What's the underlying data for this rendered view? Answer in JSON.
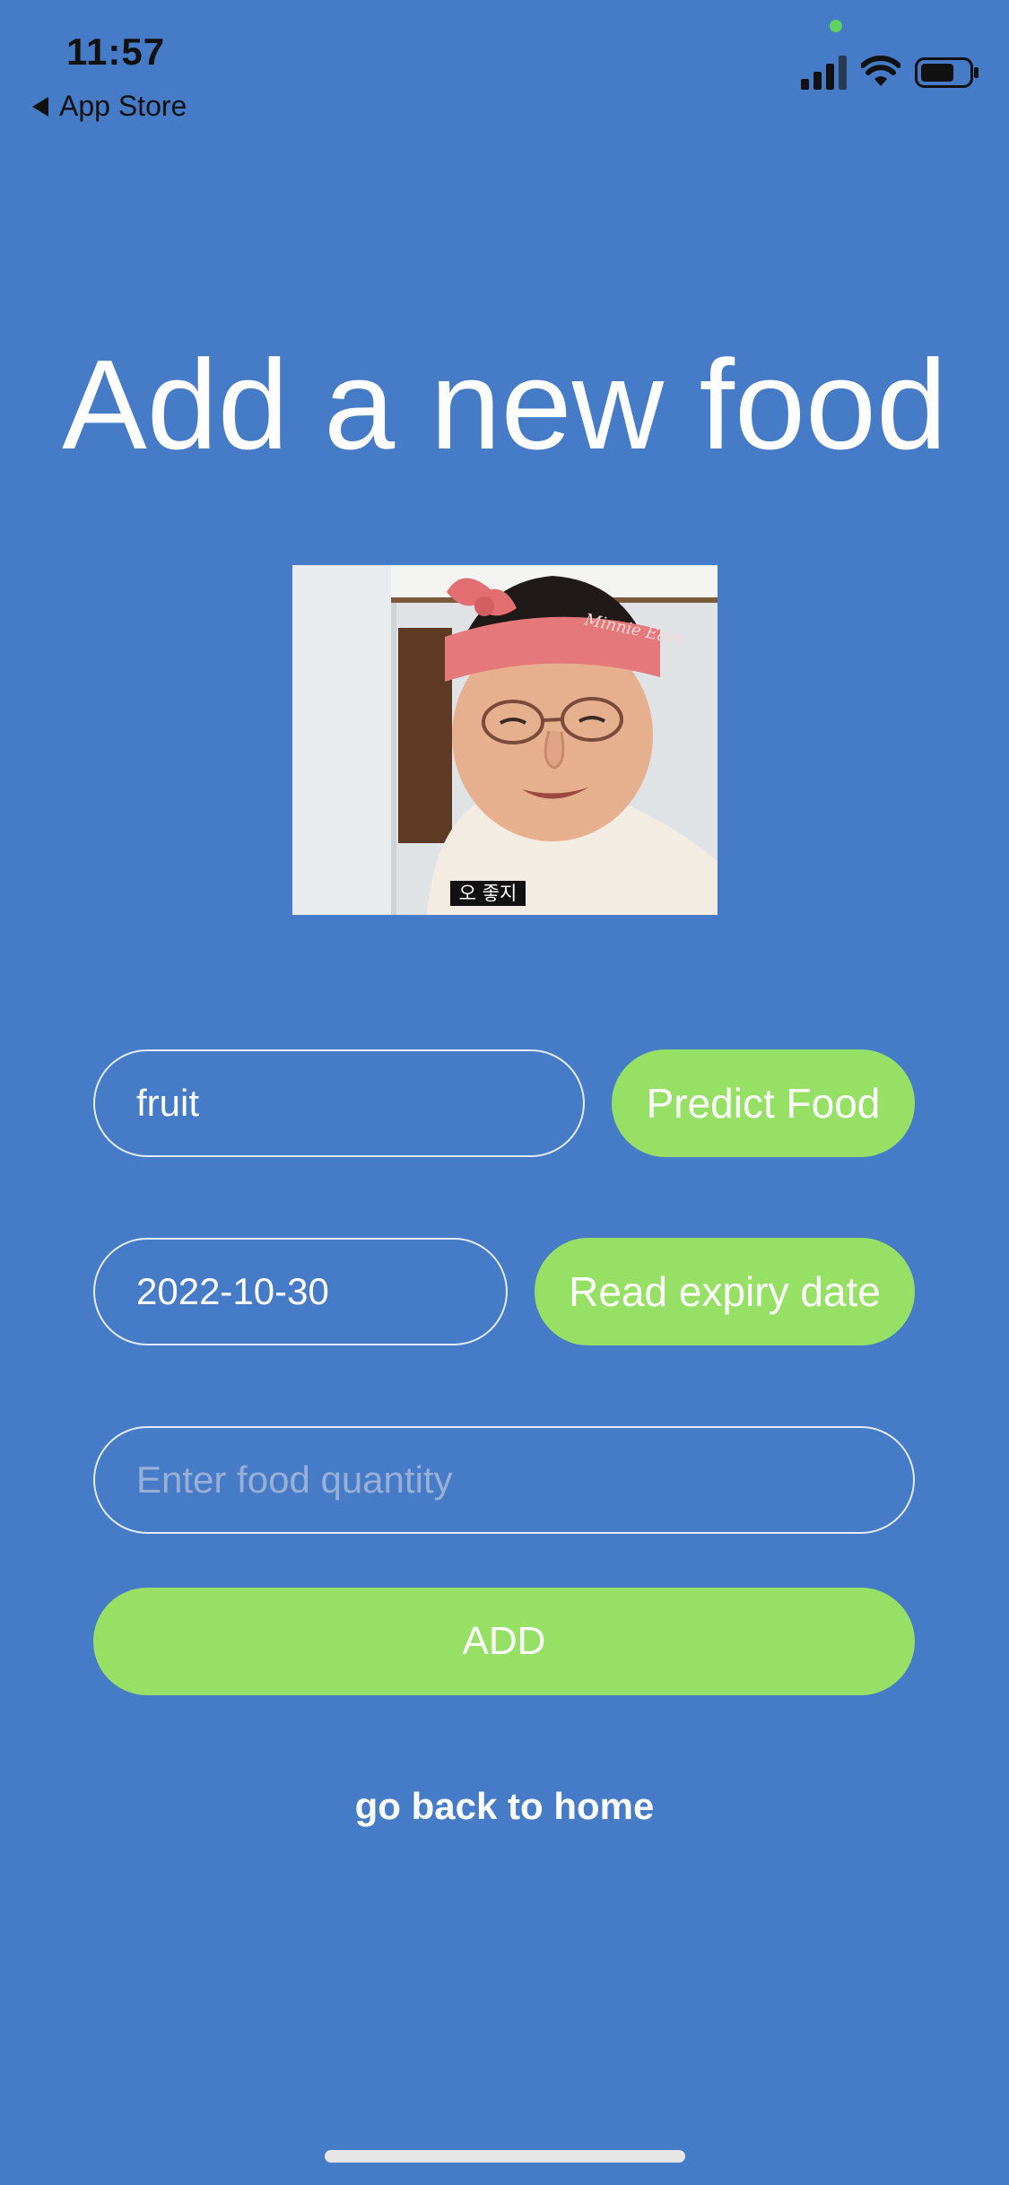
{
  "status_bar": {
    "time": "11:57",
    "back_label": "App Store",
    "icons": [
      "signal-icon",
      "wifi-icon",
      "battery-icon"
    ]
  },
  "page": {
    "title": "Add a new food",
    "background_color": "#467bc7",
    "accent_color": "#95e065"
  },
  "photo": {
    "subtitle_text": "오 좋지",
    "headband_text": "Minnie Ears"
  },
  "form": {
    "food_name_value": "fruit",
    "predict_button_label": "Predict Food",
    "expiry_value": "2022-10-30",
    "read_expiry_button_label": "Read expiry date",
    "quantity_placeholder": "Enter food quantity",
    "add_button_label": "ADD"
  },
  "footer": {
    "home_link_label": "go back to home"
  }
}
